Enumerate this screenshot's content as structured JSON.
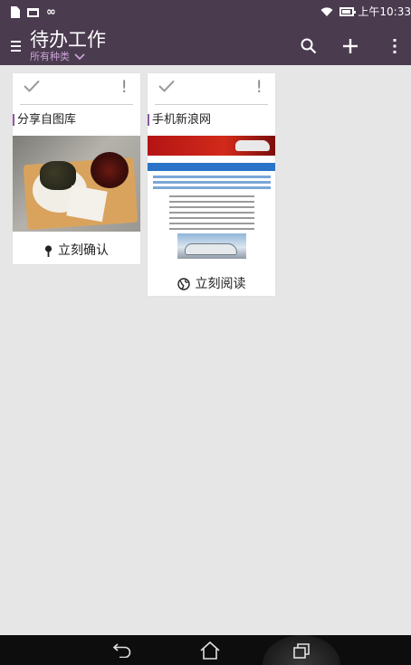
{
  "status_bar": {
    "time": "上午10:33",
    "icons": [
      "file-icon",
      "mail-icon",
      "infinity-icon",
      "wifi-icon",
      "battery-charging-icon"
    ]
  },
  "header": {
    "title": "待办工作",
    "filter_label": "所有种类",
    "actions": [
      "search-icon",
      "add-icon",
      "overflow-menu-icon"
    ]
  },
  "cards": [
    {
      "title": "分享自图库",
      "action_label": "立刻确认",
      "action_icon": "pin-icon",
      "thumbnail": "photo-of-meal-tray"
    },
    {
      "title": "手机新浪网",
      "action_label": "立刻阅读",
      "action_icon": "globe-icon",
      "thumbnail": "web-page-screenshot"
    }
  ],
  "nav_bar": {
    "buttons": [
      "back-icon",
      "home-icon",
      "recent-apps-icon"
    ]
  },
  "colors": {
    "header_bg": "#4a3b4f",
    "accent": "#8e5aa0",
    "filter_text": "#c9a2d4",
    "content_bg": "#e6e6e6",
    "nav_bg": "#0d0d0d"
  }
}
